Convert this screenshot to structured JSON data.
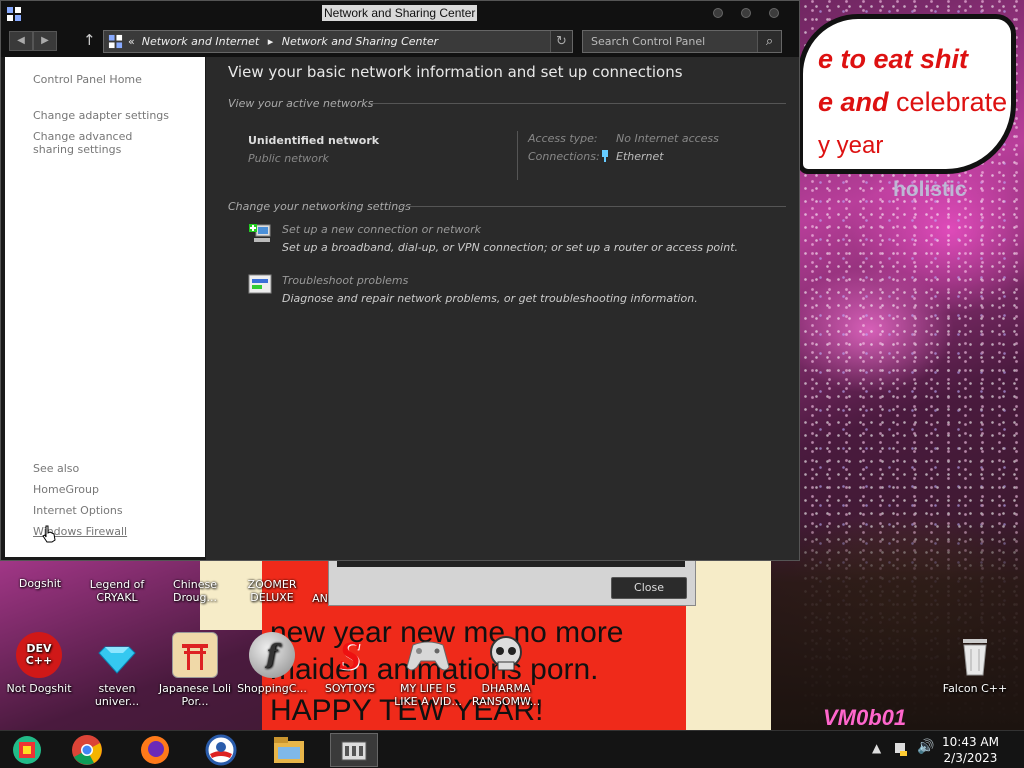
{
  "window": {
    "title": "Network and Sharing Center",
    "address_prefix": "«",
    "breadcrumb": [
      "Network and Internet",
      "Network and Sharing Center"
    ],
    "search_placeholder": "Search Control Panel"
  },
  "left_pane": {
    "home": "Control Panel Home",
    "links": [
      "Change adapter settings",
      "Change advanced sharing settings"
    ],
    "see_also_header": "See also",
    "see_also": [
      "HomeGroup",
      "Internet Options",
      "Windows Firewall"
    ]
  },
  "main": {
    "heading": "View your basic network information and set up connections",
    "active_networks_header": "View your active networks",
    "network_name": "Unidentified network",
    "network_type": "Public network",
    "access_type_label": "Access type:",
    "access_type_value": "No Internet access",
    "connections_label": "Connections:",
    "connections_value": "Ethernet",
    "change_settings_header": "Change your networking settings",
    "tasks": [
      {
        "title": "Set up a new connection or network",
        "desc": "Set up a broadband, dial-up, or VPN connection; or set up a router or access point.",
        "icon": "new-connection-icon"
      },
      {
        "title": "Troubleshoot problems",
        "desc": "Diagnose and repair network problems, or get troubleshooting information.",
        "icon": "troubleshoot-icon"
      }
    ]
  },
  "background_dialog": {
    "close_label": "Close"
  },
  "wallpaper": {
    "bubble_line1": "e to eat shit",
    "bubble_line2a": "e and",
    "bubble_line2b": "celebrate",
    "bubble_line3": "y year",
    "holistic": "holistic",
    "poster_text": "new year new me no more maiden animations porn.",
    "poster_text2": "HAPPY TEW YEAR!",
    "signature": "VM0b01"
  },
  "desktop_icons_row1": [
    "Dogshit",
    "Legend of CRYAKL",
    "Chinese Droug...",
    "ZOOMER DELUXE",
    "AN"
  ],
  "desktop_icons_row2": [
    {
      "label": "Not Dogshit",
      "icon": "dev-cpp-icon",
      "badge": "DEV C++"
    },
    {
      "label": "steven univer...",
      "icon": "diamond-icon"
    },
    {
      "label": "Japanese Loli Por...",
      "icon": "torii-icon"
    },
    {
      "label": "ShoppingC...",
      "icon": "flash-icon"
    },
    {
      "label": "SOYTOYS",
      "icon": "soytoys-icon"
    },
    {
      "label": "MY LIFE IS LIKE A VID...",
      "icon": "gamepad-icon"
    },
    {
      "label": "DHARMA RANSOMW...",
      "icon": "skull-icon"
    }
  ],
  "recycle_bin_label": "Falcon C++",
  "taskbar": {
    "apps": [
      "control-panel-icon",
      "chrome-icon",
      "firefox-icon",
      "obama-logo-icon",
      "file-explorer-icon",
      "network-center-icon"
    ],
    "time": "10:43 AM",
    "date": "2/3/2023"
  },
  "colors": {
    "window_bg": "#2a2a2a",
    "left_pane_bg": "#ffffff",
    "poster_red": "#ef2a1a",
    "speech_red": "#d11111"
  }
}
